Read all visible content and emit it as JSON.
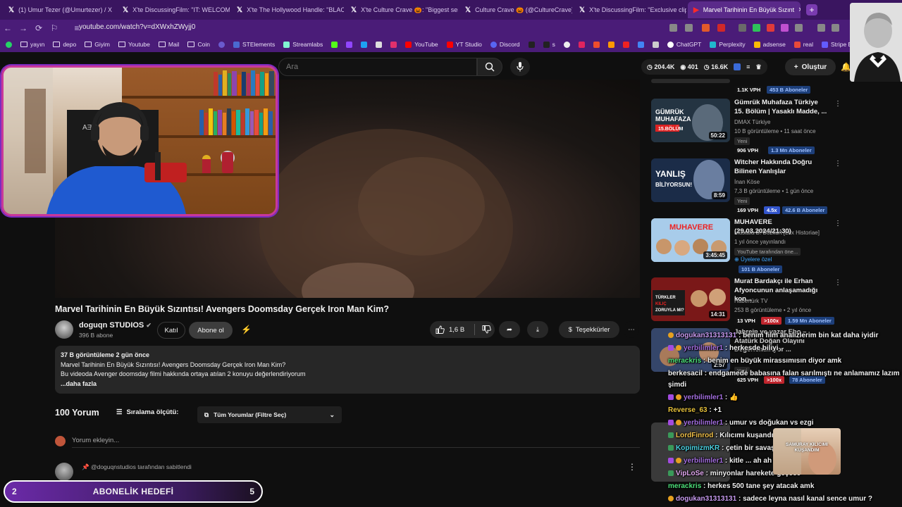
{
  "browser": {
    "tabs": [
      {
        "label": "(1) Umur Tezer (@Umurtezer) / X"
      },
      {
        "label": "X'te DiscussingFilm: \"IT: WELCOME"
      },
      {
        "label": "X'te The Hollywood Handle: \"BLAC"
      },
      {
        "label": "X'te Culture Crave 🎃: \"Biggest seri"
      },
      {
        "label": "Culture Crave 🎃 (@CultureCrave)"
      },
      {
        "label": "X'te DiscussingFilm: \"Exclusive clip"
      },
      {
        "label": "Marvel Tarihinin En Büyük Sızınt"
      }
    ],
    "url": "youtube.com/watch?v=dXWxhZWyjj0",
    "bookmarks": [
      {
        "label": "yayın",
        "type": "site"
      },
      {
        "label": "depo",
        "type": "folder"
      },
      {
        "label": "Giyim",
        "type": "folder"
      },
      {
        "label": "Youtube",
        "type": "folder"
      },
      {
        "label": "Mail",
        "type": "folder"
      },
      {
        "label": "Coin",
        "type": "folder"
      },
      {
        "label": "STElements",
        "type": "site"
      },
      {
        "label": "Streamlabs",
        "type": "site"
      },
      {
        "label": "YouTube",
        "type": "site"
      },
      {
        "label": "YT Studio",
        "type": "site"
      },
      {
        "label": "Discord",
        "type": "site"
      },
      {
        "label": "s",
        "type": "site"
      },
      {
        "label": "ChatGPT",
        "type": "site"
      },
      {
        "label": "Perplexity",
        "type": "site"
      },
      {
        "label": "adsense",
        "type": "site"
      },
      {
        "label": "real",
        "type": "site"
      },
      {
        "label": "Stripe Expre",
        "type": "site"
      }
    ]
  },
  "header": {
    "search_placeholder": "Ara",
    "stats": [
      "204.4K",
      "401",
      "16.6K"
    ],
    "create_label": "Oluştur"
  },
  "video": {
    "title": "Marvel Tarihinin En Büyük Sızıntısı! Avengers Doomsday Gerçek Iron Man Kim?",
    "channel": "doguqn STUDIOS",
    "subscribers": "396 B abone",
    "join_label": "Katıl",
    "subscribe_label": "Abone ol",
    "likes": "1,6 B",
    "thanks_label": "Teşekkürler",
    "description": {
      "meta": "37 B görüntüleme  2 gün önce",
      "line1": "Marvel Tarihinin En Büyük Sızıntısı! Avengers Doomsday Gerçek Iron Man Kim?",
      "line2": "Bu videoda Avenger doomsday filmi hakkında ortaya atılan 2 konuyu değerlendiriyorum",
      "more": "...daha fazla"
    }
  },
  "comments": {
    "count": "100 Yorum",
    "sort_label": "Sıralama ölçütü:",
    "filter_label": "Tüm Yorumlar (Filtre Seç)",
    "input_placeholder": "Yorum ekleyin...",
    "pinned_label": "@doguqnstudios tarafından sabitlendi"
  },
  "subgoal": {
    "left": "2",
    "label": "ABONELİK HEDEFİ",
    "right": "5"
  },
  "sidebar": [
    {
      "title": "",
      "channel": "",
      "stats": "",
      "badge": "",
      "vph": "1.1K VPH",
      "subs": "453 B Aboneler",
      "duration": ""
    },
    {
      "title": "Gümrük Muhafaza Türkiye 15. Bölüm | Yasaklı Madde, ...",
      "channel": "DMAX Türkiye",
      "stats": "10 B görüntüleme • 11 saat önce",
      "badge": "Yeni",
      "vph": "906 VPH",
      "subs": "1.3 Mn Aboneler",
      "duration": "50:22"
    },
    {
      "title": "Witcher Hakkında Doğru Bilinen Yanlışlar",
      "channel": "İnan Köse",
      "stats": "7,3 B görüntüleme • 1 gün önce",
      "badge": "Yeni",
      "vph": "169 VPH",
      "mult": "4.5x",
      "subs": "42.6 B Aboneler",
      "duration": "8:59"
    },
    {
      "title": "MUHAVERE (29.03.2024/21:30)",
      "channel": "Mustafa B. Bozkurt [Lex Historiae]",
      "stats": "1 yıl önce yayınlandı",
      "badge": "YouTube tarafından öne...",
      "members": "Üyelere özel",
      "subs": "101 B Aboneler",
      "duration": "3:45:45"
    },
    {
      "title": "Murat Bardakçı ile Erhan Afyoncunun anlaşamadığı kon...",
      "channel": "Habertürk TV",
      "stats": "253 B görüntüleme • 2 yıl önce",
      "vph": "13 VPH",
      "mult": ">100x",
      "subs": "1.59 Mn Aboneler",
      "duration": "14:31"
    },
    {
      "title": "Jahrein ve yazar Ebo – Atatürk Doğan Olayını Değerlendiriyor ...",
      "badge": "Yeni",
      "vph": "625 VPH",
      "mult": ">100x",
      "subs": "78 Aboneler",
      "duration": "2:57"
    }
  ],
  "chat": [
    {
      "user": "dogukan31313131",
      "text": "benim film analizlerim bin kat daha iyidir",
      "color": "#c89bf0"
    },
    {
      "user": "yerbilimler1",
      "text": "herkesde biliyi",
      "color": "#a46fe0"
    },
    {
      "user": "merackris",
      "text": "benim en büyük mirassımısın diyor amk",
      "color": "#4de07a"
    },
    {
      "user": "berkesacil",
      "text": "endgamede babasına falan sarılmıştı ne anlamamız lazım",
      "color": "#f1f1f1"
    },
    {
      "user": "",
      "text": "şimdi",
      "color": "#f1f1f1"
    },
    {
      "user": "yerbilimler1",
      "text": "👍",
      "color": "#a46fe0"
    },
    {
      "user": "Reverse_63",
      "text": "+1",
      "color": "#e6c13b"
    },
    {
      "user": "yerbilimler1",
      "text": "umur vs doğukan vs ezgi",
      "color": "#a46fe0"
    },
    {
      "user": "LordFinrod",
      "text": "Kılıcımı kuşandım bekliyorum",
      "color": "#f1c04a"
    },
    {
      "user": "KopimizmKR",
      "text": "çetin bir savaş olacak gibi",
      "color": "#4ad0e0"
    },
    {
      "user": "yerbilimler1",
      "text": "kitle ... ah ah",
      "color": "#a46fe0"
    },
    {
      "user": "VipLoSe",
      "text": "minyonlar harekete geçece",
      "color": "#e2a8f0"
    },
    {
      "user": "merackris",
      "text": "herkes 500 tane şey atacak amk",
      "color": "#4de07a"
    },
    {
      "user": "dogukan31313131",
      "text": "sadece leyna nasıl kanal sence umur ?",
      "color": "#c89bf0"
    }
  ],
  "gif": {
    "caption": "SAMURAY KILICIMI KUŞANDIM"
  }
}
